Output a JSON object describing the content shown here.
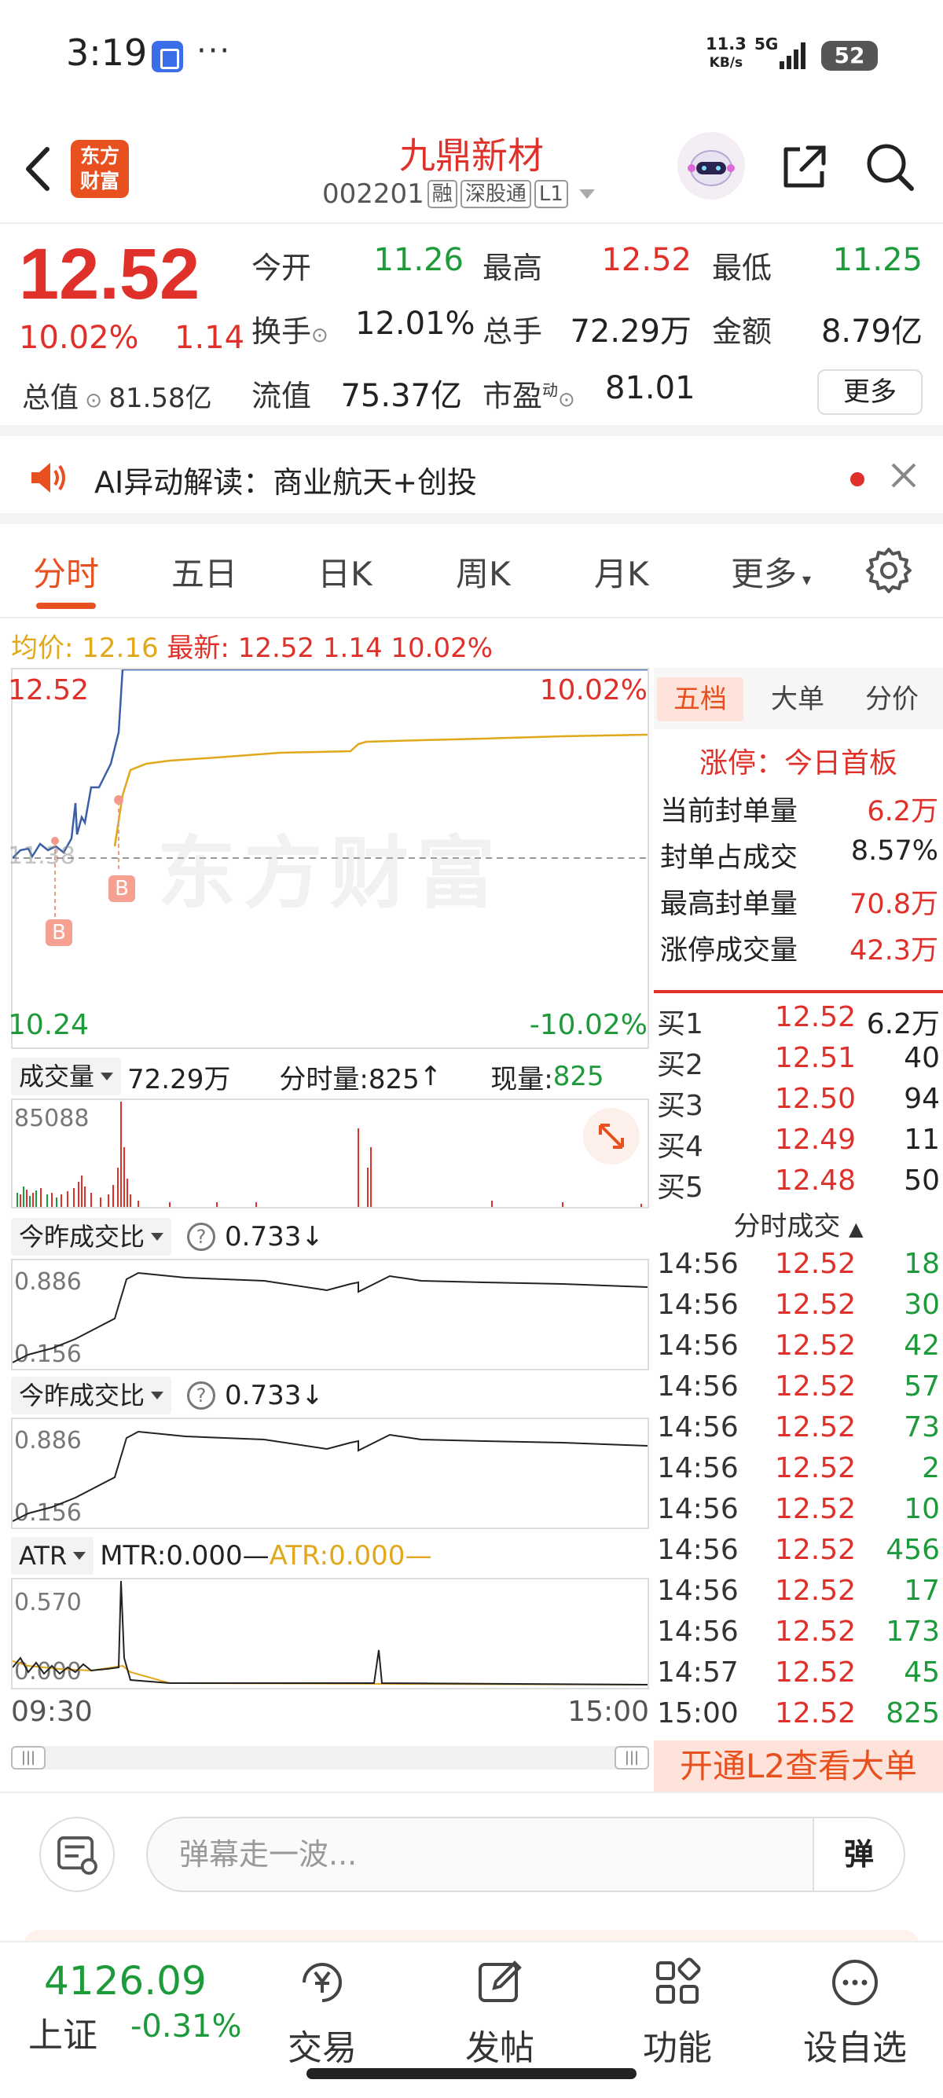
{
  "status_bar": {
    "time": "3:19",
    "dots": "···",
    "speed_value": "11.3",
    "speed_unit": "KB/s",
    "network": "5G",
    "battery": "52"
  },
  "header": {
    "stock_name": "九鼎新材",
    "stock_code": "002201",
    "tags": [
      "融",
      "深股通",
      "L1"
    ],
    "logo_line1": "东方",
    "logo_line2": "财富"
  },
  "quote": {
    "price": "12.52",
    "change_pct": "10.02%",
    "change_amt": "1.14",
    "market_cap_label": "总值",
    "market_cap_value": "81.58亿",
    "open_label": "今开",
    "open_value": "11.26",
    "high_label": "最高",
    "high_value": "12.52",
    "low_label": "最低",
    "low_value": "11.25",
    "turnover_label": "换手",
    "turnover_value": "12.01%",
    "volume_label": "总手",
    "volume_value": "72.29万",
    "amount_label": "金额",
    "amount_value": "8.79亿",
    "float_label": "流值",
    "float_value": "75.37亿",
    "pe_label": "市盈",
    "pe_sup": "动",
    "pe_value": "81.01",
    "more_label": "更多"
  },
  "ai_bar": {
    "text": "AI异动解读：商业航天+创投"
  },
  "tabs": [
    "分时",
    "五日",
    "日K",
    "周K",
    "月K",
    "更多"
  ],
  "avg_info": {
    "avg_label": "均价:",
    "avg_value": "12.16",
    "latest_label": "最新:",
    "latest_value": "12.52",
    "latest_chg": "1.14",
    "latest_pct": "10.02%"
  },
  "main_chart": {
    "top_price": "12.52",
    "top_pct": "10.02%",
    "bottom_price": "10.24",
    "bottom_pct": "-10.02%",
    "ref_price": "11.38",
    "marker_b": "B",
    "watermark": "东方财富"
  },
  "volume_panel": {
    "selector": "成交量",
    "total": "72.29万",
    "tick_label": "分时量:825",
    "now_label": "现量:",
    "now_value": "825",
    "max": "85088"
  },
  "ratio_panel_1": {
    "selector": "今昨成交比",
    "value": "0.733",
    "max": "0.886",
    "min": "0.156"
  },
  "ratio_panel_2": {
    "selector": "今昨成交比",
    "value": "0.733",
    "max": "0.886",
    "min": "0.156"
  },
  "atr_panel": {
    "selector": "ATR",
    "mtr": "MTR:0.000",
    "atr": "ATR:0.000",
    "max": "0.570",
    "min": "0.000"
  },
  "time_axis": {
    "start": "09:30",
    "end": "15:00"
  },
  "right_panel": {
    "tabs": [
      "五档",
      "大单",
      "分价"
    ],
    "limit_title": "涨停：今日首板",
    "limit_rows": [
      {
        "label": "当前封单量",
        "value": "6.2万"
      },
      {
        "label": "封单占成交",
        "value": "8.57%"
      },
      {
        "label": "最高封单量",
        "value": "70.8万"
      },
      {
        "label": "涨停成交量",
        "value": "42.3万"
      }
    ],
    "order_book": [
      {
        "label": "买1",
        "price": "12.52",
        "qty": "6.2万"
      },
      {
        "label": "买2",
        "price": "12.51",
        "qty": "40"
      },
      {
        "label": "买3",
        "price": "12.50",
        "qty": "94"
      },
      {
        "label": "买4",
        "price": "12.49",
        "qty": "11"
      },
      {
        "label": "买5",
        "price": "12.48",
        "qty": "50"
      }
    ],
    "ticks_title": "分时成交",
    "ticks": [
      {
        "time": "14:56",
        "price": "12.52",
        "qty": "18"
      },
      {
        "time": "14:56",
        "price": "12.52",
        "qty": "30"
      },
      {
        "time": "14:56",
        "price": "12.52",
        "qty": "42"
      },
      {
        "time": "14:56",
        "price": "12.52",
        "qty": "57"
      },
      {
        "time": "14:56",
        "price": "12.52",
        "qty": "73"
      },
      {
        "time": "14:56",
        "price": "12.52",
        "qty": "2"
      },
      {
        "time": "14:56",
        "price": "12.52",
        "qty": "10"
      },
      {
        "time": "14:56",
        "price": "12.52",
        "qty": "456"
      },
      {
        "time": "14:56",
        "price": "12.52",
        "qty": "17"
      },
      {
        "time": "14:56",
        "price": "12.52",
        "qty": "173"
      },
      {
        "time": "14:57",
        "price": "12.52",
        "qty": "45"
      },
      {
        "time": "15:00",
        "price": "12.52",
        "qty": "825"
      }
    ],
    "l2_button": "开通L2查看大单"
  },
  "barrage": {
    "placeholder": "弹幕走一波...",
    "button": "弹"
  },
  "bottom_nav": {
    "index_value": "4126.09",
    "index_name": "上证",
    "index_change": "-0.31%",
    "items": [
      "交易",
      "发帖",
      "功能",
      "设自选"
    ]
  },
  "colors": {
    "up": "#e0302a",
    "down": "#1d9a3a",
    "accent": "#e8501f",
    "avg_line": "#e0a81a",
    "price_line": "#3a5fa8"
  }
}
